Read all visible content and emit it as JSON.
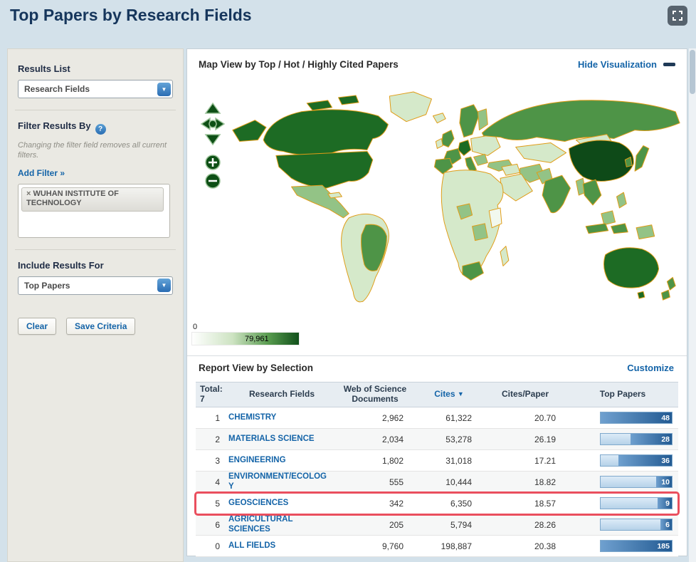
{
  "page": {
    "title": "Top Papers by Research Fields"
  },
  "colors": {
    "link_blue": "#1464a8",
    "highlight_red": "#ea4f5e",
    "map_max_green": "#11501b",
    "bar_blue": "#225a92"
  },
  "icons": {
    "help": "?",
    "dropdown_arrow": "▼",
    "sort_desc": "▼",
    "remove_tag": "×"
  },
  "sidebar": {
    "results_list": {
      "heading": "Results List",
      "selected": "Research Fields"
    },
    "filter": {
      "heading": "Filter Results By",
      "note": "Changing the filter field removes all current filters.",
      "add_filter_label": "Add Filter »",
      "tags": [
        {
          "label": "WUHAN INSTITUTE OF TECHNOLOGY"
        }
      ]
    },
    "include": {
      "heading": "Include Results For",
      "selected": "Top Papers"
    },
    "buttons": {
      "clear": "Clear",
      "save": "Save Criteria"
    }
  },
  "main": {
    "map": {
      "title": "Map View by Top / Hot / Highly Cited Papers",
      "hide_label": "Hide Visualization",
      "legend": {
        "min": "0",
        "max": "79,961"
      }
    },
    "report": {
      "title": "Report View by Selection",
      "customize_label": "Customize",
      "table": {
        "total_label": "Total:",
        "total_count": "7",
        "headers": {
          "fields": "Research Fields",
          "docs": "Web of Science Documents",
          "cites": "Cites",
          "cites_per_paper": "Cites/Paper",
          "top_papers": "Top Papers"
        },
        "rows": [
          {
            "rank": "1",
            "field": "CHEMISTRY",
            "docs": "2,962",
            "cites": "61,322",
            "cites_per_paper": "20.70",
            "top_papers": "48",
            "bar_pct": 100
          },
          {
            "rank": "2",
            "field": "MATERIALS SCIENCE",
            "docs": "2,034",
            "cites": "53,278",
            "cites_per_paper": "26.19",
            "top_papers": "28",
            "bar_pct": 58
          },
          {
            "rank": "3",
            "field": "ENGINEERING",
            "docs": "1,802",
            "cites": "31,018",
            "cites_per_paper": "17.21",
            "top_papers": "36",
            "bar_pct": 75
          },
          {
            "rank": "4",
            "field": "ENVIRONMENT/ECOLOGY",
            "docs": "555",
            "cites": "10,444",
            "cites_per_paper": "18.82",
            "top_papers": "10",
            "bar_pct": 22
          },
          {
            "rank": "5",
            "field": "GEOSCIENCES",
            "docs": "342",
            "cites": "6,350",
            "cites_per_paper": "18.57",
            "top_papers": "9",
            "bar_pct": 20,
            "highlighted": true
          },
          {
            "rank": "6",
            "field": "AGRICULTURAL SCIENCES",
            "docs": "205",
            "cites": "5,794",
            "cites_per_paper": "28.26",
            "top_papers": "6",
            "bar_pct": 15
          },
          {
            "rank": "0",
            "field": "ALL FIELDS",
            "docs": "9,760",
            "cites": "198,887",
            "cites_per_paper": "20.38",
            "top_papers": "185",
            "bar_pct": 100
          }
        ]
      }
    }
  }
}
